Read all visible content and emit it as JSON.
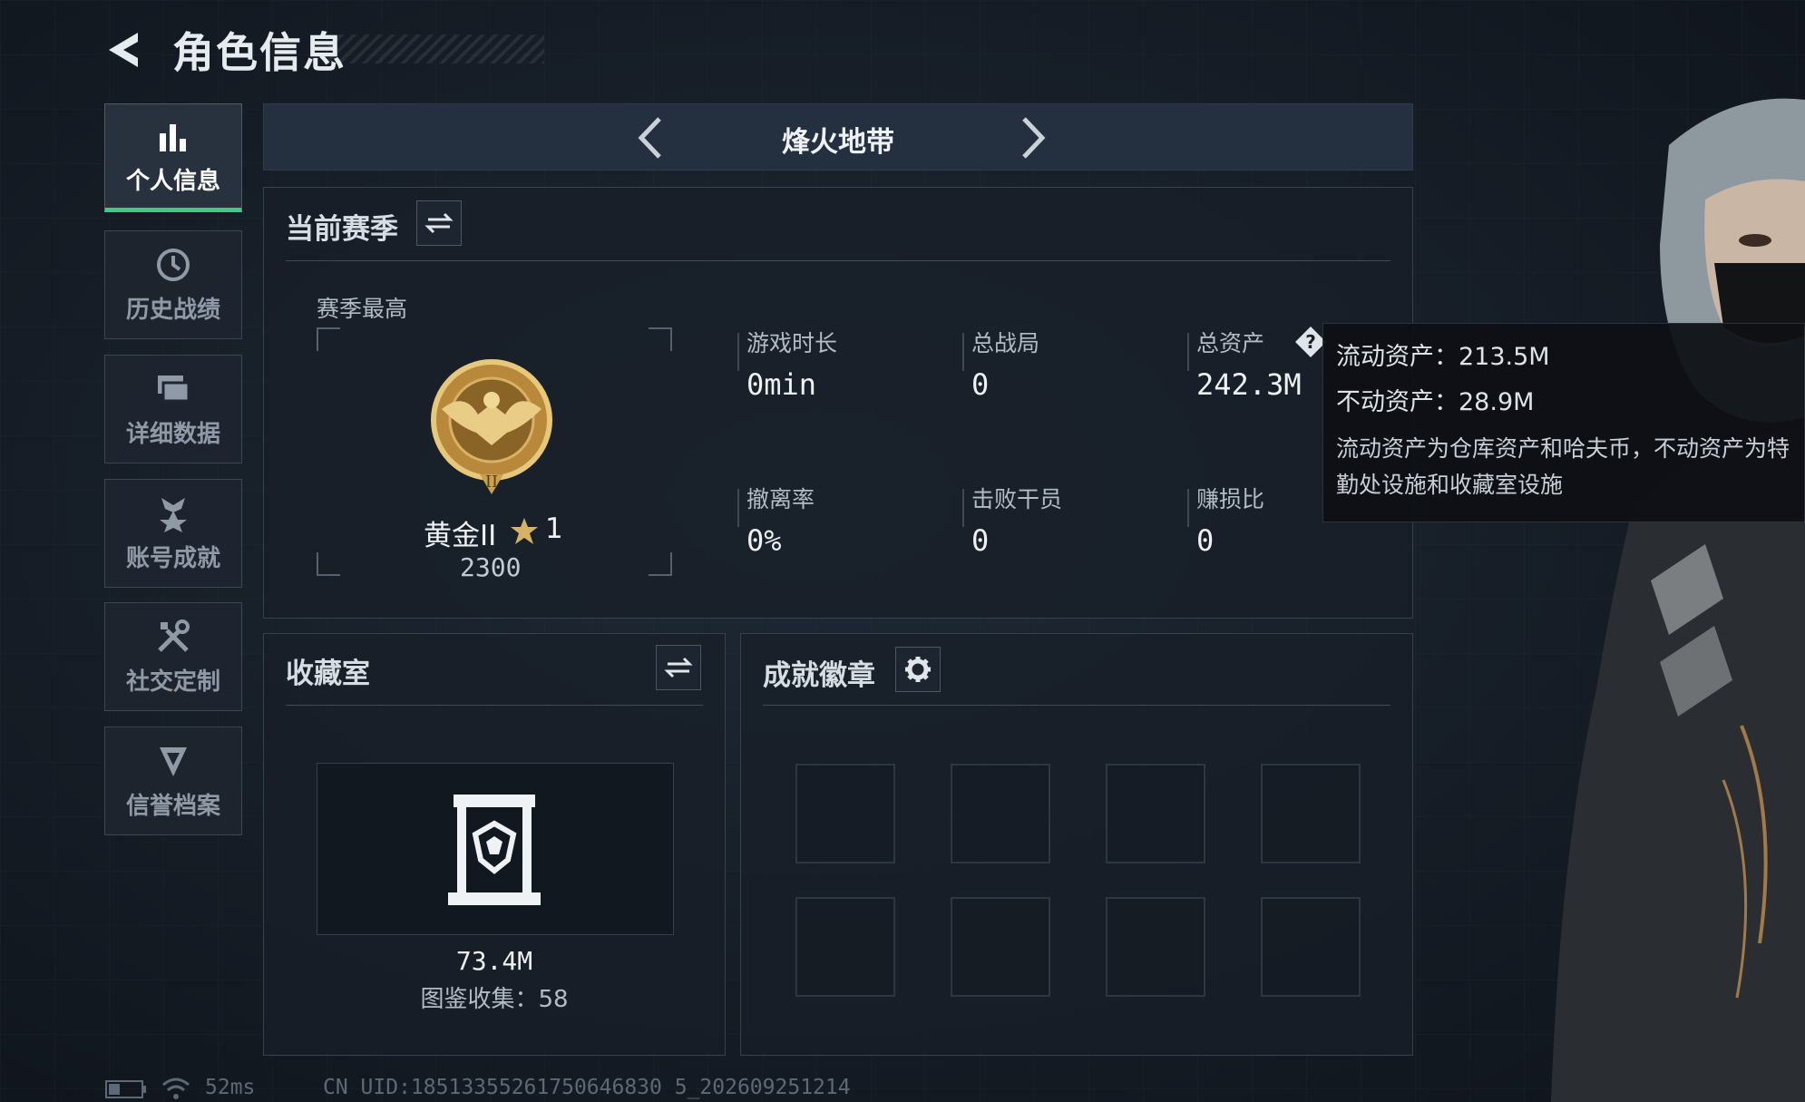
{
  "header": {
    "title": "角色信息"
  },
  "sidebar": {
    "items": [
      {
        "label": "个人信息",
        "icon": "bar-chart-icon",
        "active": true
      },
      {
        "label": "历史战绩",
        "icon": "clock-icon",
        "active": false
      },
      {
        "label": "详细数据",
        "icon": "stack-icon",
        "active": false
      },
      {
        "label": "账号成就",
        "icon": "medal-icon",
        "active": false
      },
      {
        "label": "社交定制",
        "icon": "tools-icon",
        "active": false
      },
      {
        "label": "信誉档案",
        "icon": "shield-badge-icon",
        "active": false
      }
    ]
  },
  "mode": {
    "name": "烽火地带"
  },
  "season": {
    "title": "当前赛季",
    "best_label": "赛季最高",
    "rank_name": "黄金II",
    "rank_stars": "1",
    "rank_score": "2300",
    "stats": [
      {
        "label": "游戏时长",
        "value": "0min"
      },
      {
        "label": "总战局",
        "value": "0"
      },
      {
        "label": "总资产",
        "value": "242.3M"
      },
      {
        "label": "撤离率",
        "value": "0%"
      },
      {
        "label": "击败干员",
        "value": "0"
      },
      {
        "label": "赚损比",
        "value": "0"
      }
    ]
  },
  "tooltip": {
    "liquid": "流动资产：213.5M",
    "fixed": "不动资产：28.9M",
    "description": "流动资产为仓库资产和哈夫币，不动资产为特勤处设施和收藏室设施"
  },
  "collection": {
    "title": "收藏室",
    "value": "73.4M",
    "count_text": "图鉴收集：58"
  },
  "badges": {
    "title": "成就徽章",
    "slots": 8
  },
  "footer": {
    "ping": "52ms",
    "uid": "CN UID:18513355261750646830 5_202609251214"
  },
  "colors": {
    "accent": "#3ec986",
    "gold": "#c9a24a"
  }
}
